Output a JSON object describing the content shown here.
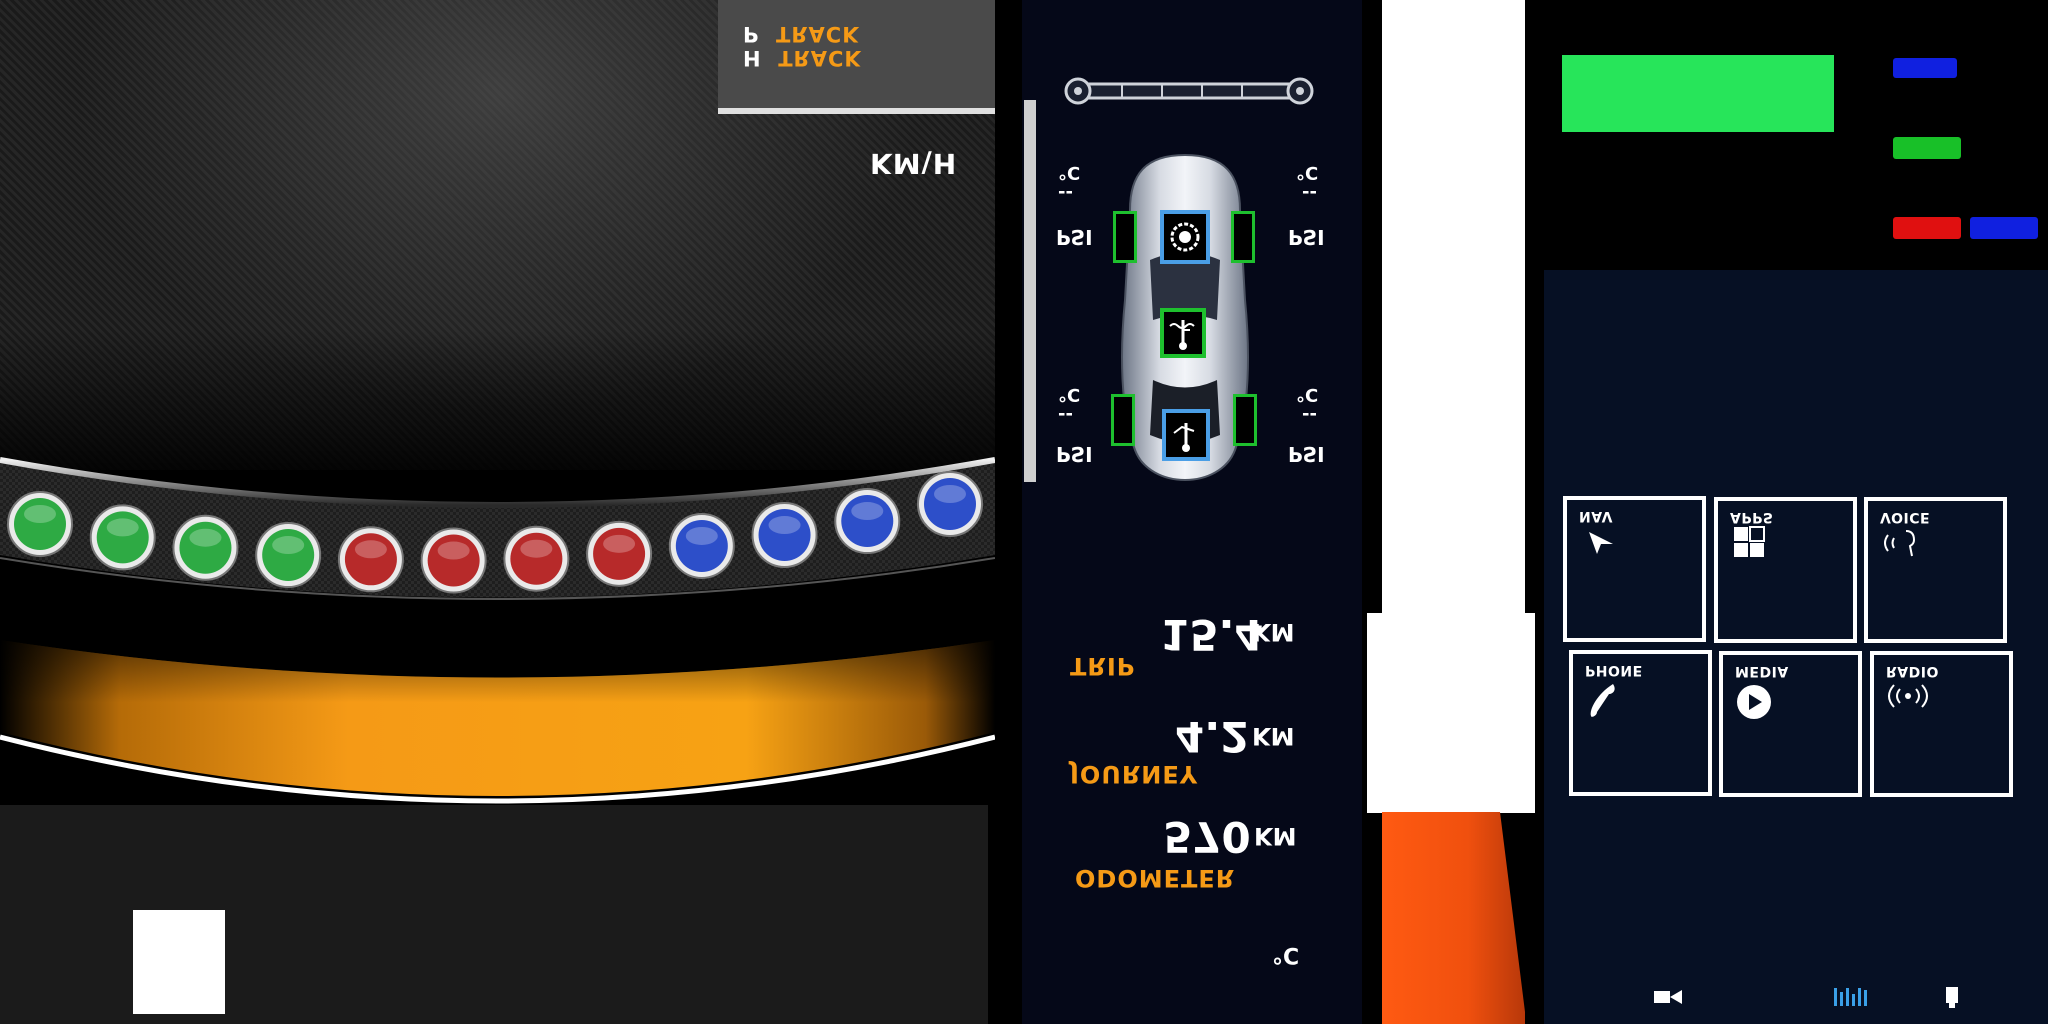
{
  "dash": {
    "track_line_1_prefix": "H",
    "track_line_1_word": "TRACK",
    "track_line_2_prefix": "P",
    "track_line_2_word": "TRACK",
    "speed_unit": "KM\\H",
    "shift_lights": [
      {
        "color": "#2eaa44"
      },
      {
        "color": "#2eaa44"
      },
      {
        "color": "#2eaa44"
      },
      {
        "color": "#2eaa44"
      },
      {
        "color": "#b72a2a"
      },
      {
        "color": "#b72a2a"
      },
      {
        "color": "#b72a2a"
      },
      {
        "color": "#b72a2a"
      },
      {
        "color": "#2d4fc9"
      },
      {
        "color": "#2d4fc9"
      },
      {
        "color": "#2d4fc9"
      },
      {
        "color": "#2d4fc9"
      }
    ],
    "accent_orange": "#f59a16"
  },
  "tpms": {
    "front_left": {
      "temp_unit": "°C",
      "value": "--",
      "pressure_unit": "PSI"
    },
    "front_right": {
      "temp_unit": "°C",
      "value": "--",
      "pressure_unit": "PSI"
    },
    "rear_left": {
      "temp_unit": "°C",
      "value": "--",
      "pressure_unit": "PSI"
    },
    "rear_right": {
      "temp_unit": "°C",
      "value": "--",
      "pressure_unit": "PSI"
    },
    "icons": [
      "engine-warning-icon",
      "coolant-temp-icon",
      "oil-temp-icon"
    ]
  },
  "trip": {
    "trip_value": "15.4",
    "trip_unit": "KM",
    "trip_label": "TRIP",
    "journey_value": "4.2",
    "journey_unit": "KM",
    "journey_label": "JOURNEY",
    "odometer_value": "570",
    "odometer_unit": "KM",
    "odometer_label": "ODOMETER",
    "outside_temp_unit": "°C"
  },
  "swatches": {
    "green_block": "#27e55a",
    "blue": "#1020e0",
    "green": "#18c028",
    "red": "#e01010"
  },
  "menu": {
    "tiles": [
      {
        "label": "NAV",
        "icon": "navigation-arrow-icon"
      },
      {
        "label": "APPS",
        "icon": "apps-grid-icon"
      },
      {
        "label": "VOICE",
        "icon": "voice-icon"
      },
      {
        "label": "PHONE",
        "icon": "phone-icon"
      },
      {
        "label": "MEDIA",
        "icon": "play-icon"
      },
      {
        "label": "RADIO",
        "icon": "radio-icon"
      }
    ],
    "status_icons": [
      "camera-icon",
      "signal-bars-icon",
      "battery-icon"
    ]
  }
}
